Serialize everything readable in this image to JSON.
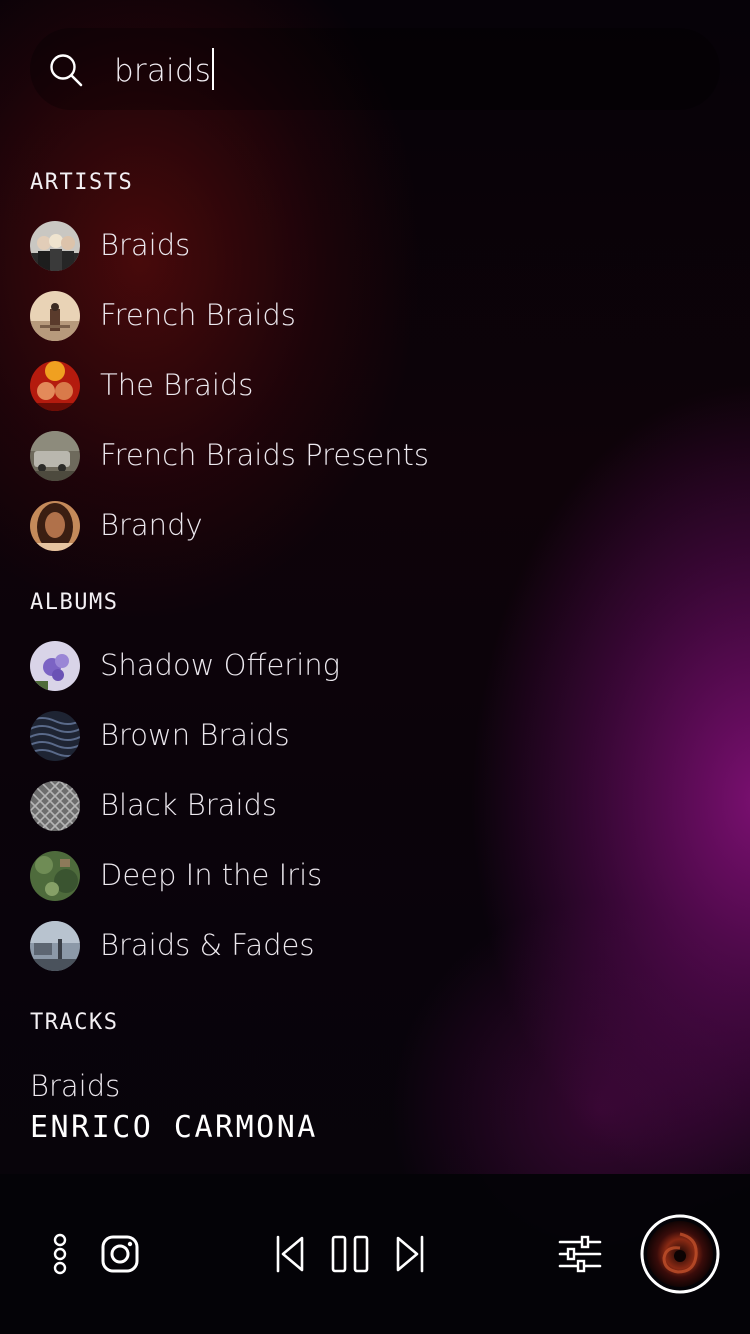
{
  "search": {
    "query": "braids"
  },
  "sections": {
    "artists_title": "ARTISTS",
    "albums_title": "ALBUMS",
    "tracks_title": "TRACKS"
  },
  "artists": [
    {
      "label": "Braids"
    },
    {
      "label": "French Braids"
    },
    {
      "label": "The Braids"
    },
    {
      "label": "French Braids Presents"
    },
    {
      "label": "Brandy"
    }
  ],
  "albums": [
    {
      "label": "Shadow Offering"
    },
    {
      "label": "Brown Braids"
    },
    {
      "label": "Black Braids"
    },
    {
      "label": "Deep In the Iris"
    },
    {
      "label": "Braids & Fades"
    }
  ],
  "tracks": [
    {
      "title": "Braids",
      "artist": "ENRICO CARMONA"
    }
  ],
  "player": {
    "icons": [
      "more-vertical-icon",
      "instagram-icon",
      "skip-previous-icon",
      "pause-icon",
      "skip-next-icon",
      "equalizer-icon",
      "now-playing-artwork"
    ]
  },
  "colors": {
    "accent_purple": "#80107a",
    "accent_red": "#5c0c0c",
    "text": "#ece8ee"
  }
}
